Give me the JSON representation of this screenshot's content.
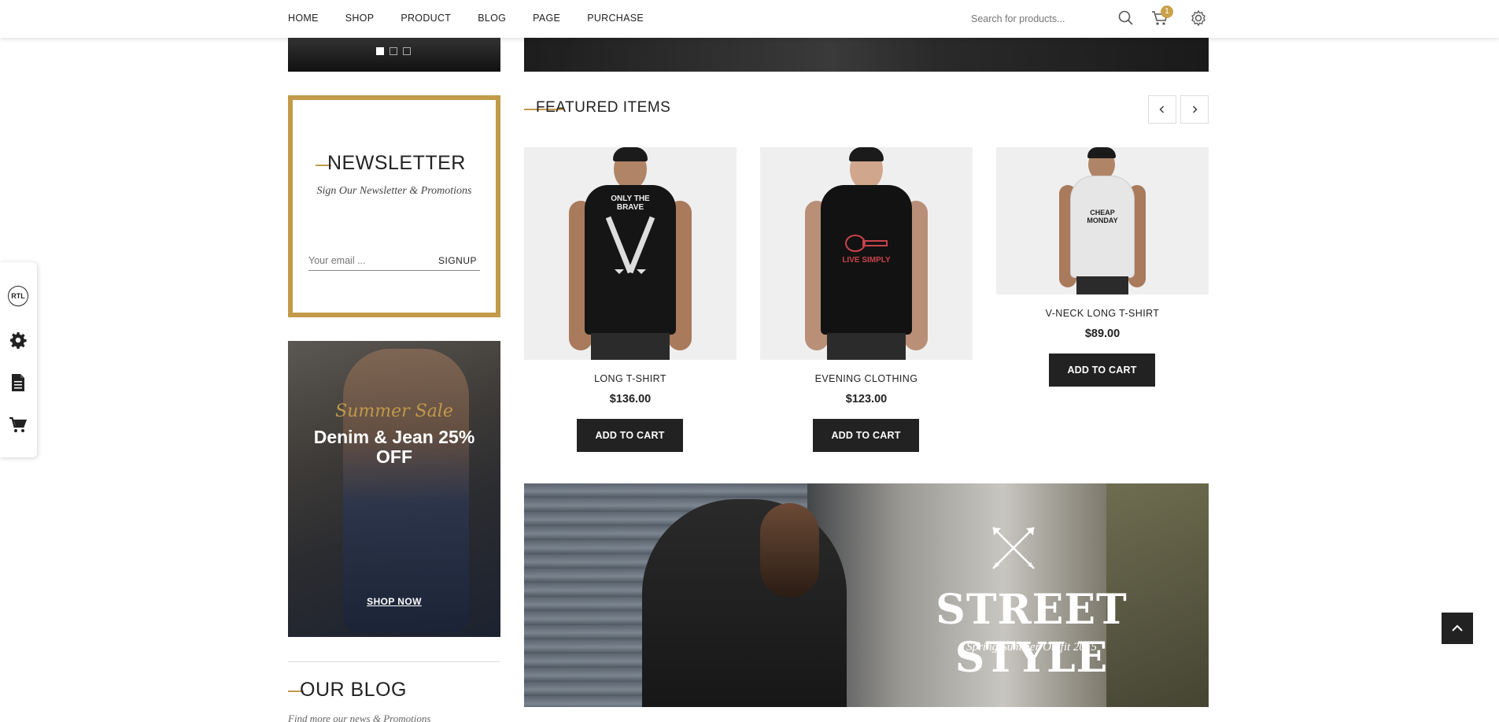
{
  "header": {
    "nav": [
      "HOME",
      "SHOP",
      "PRODUCT",
      "BLOG",
      "PAGE",
      "PURCHASE"
    ],
    "search_placeholder": "Search for products...",
    "cart_count": "1",
    "icons": [
      "search-icon",
      "cart-icon",
      "settings-gear-icon"
    ]
  },
  "side_tools": {
    "rtl_label": "RTL",
    "icons": [
      "rtl-icon",
      "gear-icon",
      "document-icon",
      "cart-icon"
    ]
  },
  "slider": {
    "dots": 3,
    "active_dot": 1
  },
  "newsletter": {
    "title": "NEWSLETTER",
    "subtitle": "Sign Our Newsletter & Promotions",
    "email_placeholder": "Your email ...",
    "signup_label": "SIGNUP"
  },
  "promo": {
    "script": "Summer Sale",
    "headline": "Denim & Jean 25% OFF",
    "link": "SHOP NOW"
  },
  "blog": {
    "title": "OUR BLOG",
    "subtitle": "Find more our news & Promotions"
  },
  "featured": {
    "title": "FEATURED ITEMS",
    "prev_icon": "chevron-left-icon",
    "next_icon": "chevron-right-icon",
    "items": [
      {
        "name": "LONG T-SHIRT",
        "price": "$136.00",
        "button": "ADD TO CART",
        "shirt_print": "ONLY THE BRAVE"
      },
      {
        "name": "EVENING CLOTHING",
        "price": "$123.00",
        "button": "ADD TO CART",
        "shirt_print": "LIVE SIMPLY"
      },
      {
        "name": "V-NECK LONG T-SHIRT",
        "price": "$89.00",
        "button": "ADD TO CART",
        "shirt_print": "CHEAP MONDAY"
      }
    ]
  },
  "street_banner": {
    "title": "STREET STYLE",
    "subtitle": "Spring/Summer Outfit 2015"
  },
  "colors": {
    "accent": "#c29a4a",
    "dark": "#222222"
  }
}
